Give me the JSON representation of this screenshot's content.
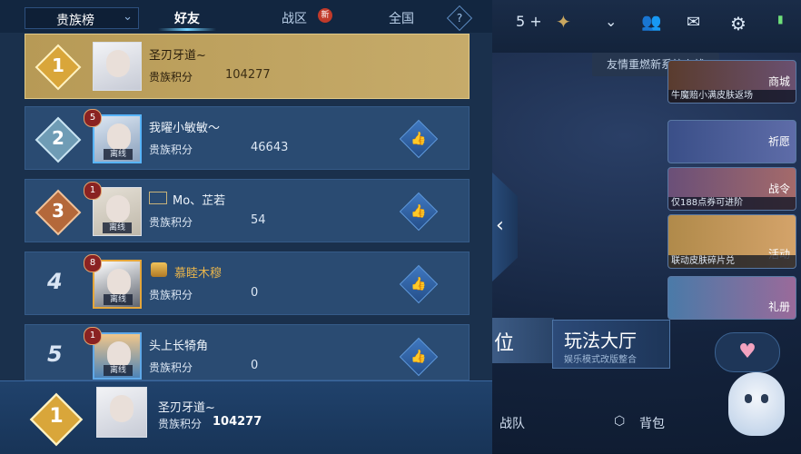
{
  "panel": {
    "selector_label": "贵族榜",
    "tabs": [
      {
        "label": "好友",
        "active": true
      },
      {
        "label": "战区",
        "active": false
      },
      {
        "label": "全国",
        "active": false
      }
    ],
    "new_badge": "新",
    "help_label": "?",
    "score_label": "贵族积分",
    "offline_label": "离线",
    "rows": [
      {
        "rank": "1",
        "name": "圣刃牙道~",
        "score": "104277",
        "is_self": true
      },
      {
        "rank": "2",
        "name": "我曜小敏敏～",
        "score": "46643",
        "level": "5"
      },
      {
        "rank": "3",
        "name": "Mo、芷若",
        "score": "54",
        "level": "1"
      },
      {
        "rank": "4",
        "name": "慕睦木穆",
        "score": "0",
        "level": "8"
      },
      {
        "rank": "5",
        "name": "头上长犄角",
        "score": "0",
        "level": "1"
      }
    ],
    "footer": {
      "rank": "1",
      "name": "圣刃牙道~",
      "score": "104277"
    }
  },
  "lobby": {
    "top_count": "5",
    "notice": "友情重燃新系统上线",
    "cards": [
      {
        "label": "商城",
        "caption": "牛魔赔小满皮肤返场"
      },
      {
        "label": "祈愿",
        "caption": ""
      },
      {
        "label": "战令",
        "caption": "仅188点券可进阶"
      },
      {
        "label": "活动",
        "caption": "联动皮肤碎片兑"
      },
      {
        "label": "礼册",
        "caption": ""
      }
    ],
    "mode_left": "位",
    "mode_hall_title": "玩法大厅",
    "mode_hall_sub": "娱乐模式改版整合",
    "bottom_left": "战队",
    "bottom_right": "背包"
  },
  "colors": {
    "accent": "#6fd0ff",
    "gold_row": "#c6ab6a",
    "row": "#2a4b72"
  }
}
